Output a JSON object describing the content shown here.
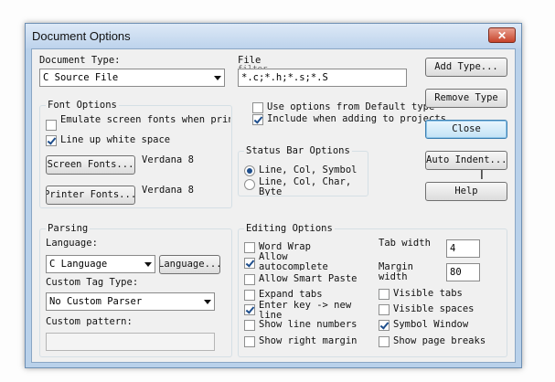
{
  "window": {
    "title": "Document Options",
    "close_glyph": "✕"
  },
  "document_type": {
    "label": "Document Type:",
    "value": "C Source File"
  },
  "file": {
    "label": "File",
    "hint": "filter",
    "value": "*.c;*.h;*.s;*.S"
  },
  "checkboxes": {
    "use_default": {
      "label": "Use options from Default type",
      "checked": false
    },
    "include_projects": {
      "label": "Include when adding to projects",
      "checked": true
    }
  },
  "buttons": {
    "add_type": "Add Type...",
    "remove_type": "Remove Type",
    "close": "Close",
    "auto_indent": "Auto Indent...",
    "help": "Help",
    "screen_fonts": "Screen Fonts...",
    "printer_fonts": "Printer Fonts...",
    "language": "Language..."
  },
  "font_options": {
    "title": "Font Options",
    "emulate": {
      "label": "Emulate screen fonts when printing",
      "checked": false
    },
    "line_up": {
      "label": "Line up white space",
      "checked": true
    },
    "screen_font_value": "Verdana 8",
    "printer_font_value": "Verdana 8"
  },
  "status_bar": {
    "title": "Status Bar Options",
    "opt1": {
      "label": "Line, Col, Symbol",
      "selected": true
    },
    "opt2": {
      "label": "Line, Col, Char, Byte",
      "selected": false
    }
  },
  "parsing": {
    "title": "Parsing",
    "language_label": "Language:",
    "language_value": "C Language",
    "custom_tag_label": "Custom Tag Type:",
    "custom_tag_value": "No Custom Parser",
    "custom_pattern_label": "Custom pattern:",
    "custom_pattern_value": ""
  },
  "editing": {
    "title": "Editing Options",
    "word_wrap": {
      "label": "Word Wrap",
      "checked": false
    },
    "allow_autocomplete": {
      "label": "Allow autocomplete",
      "checked": true
    },
    "allow_smart_paste": {
      "label": "Allow Smart Paste",
      "checked": false
    },
    "expand_tabs": {
      "label": "Expand tabs",
      "checked": false
    },
    "enter_key": {
      "label": "Enter key -> new line",
      "checked": true
    },
    "show_line_numbers": {
      "label": "Show line numbers",
      "checked": false
    },
    "show_right_margin": {
      "label": "Show right margin",
      "checked": false
    },
    "visible_tabs": {
      "label": "Visible tabs",
      "checked": false
    },
    "visible_spaces": {
      "label": "Visible spaces",
      "checked": false
    },
    "symbol_window": {
      "label": "Symbol Window",
      "checked": true
    },
    "show_page_breaks": {
      "label": "Show page breaks",
      "checked": false
    },
    "tab_label": "Tab width",
    "tab_value": "4",
    "margin_label": "Margin width",
    "margin_value": "80"
  }
}
